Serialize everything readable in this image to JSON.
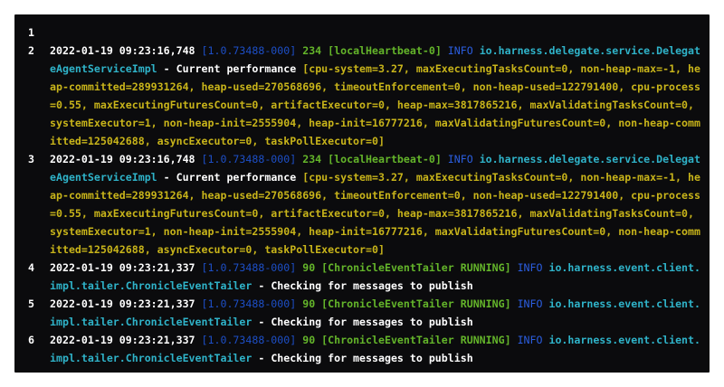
{
  "log": {
    "lines": [
      {
        "number": "1",
        "empty": true
      },
      {
        "number": "2",
        "timestamp": "2022-01-19 09:23:16,748",
        "version": "[1.0.73488-000]",
        "thread_id": "234",
        "thread": "[localHeartbeat-0]",
        "level": "INFO",
        "logger": "io.harness.delegate.service.DelegateAgentServiceImpl",
        "message": "- Current performance",
        "params": "[cpu-system=3.27, maxExecutingTasksCount=0, non-heap-max=-1, heap-committed=289931264, heap-used=270568696, timeoutEnforcement=0, non-heap-used=122791400, cpu-process=0.55, maxExecutingFuturesCount=0, artifactExecutor=0, heap-max=3817865216, maxValidatingTasksCount=0, systemExecutor=1, non-heap-init=2555904, heap-init=16777216, maxValidatingFuturesCount=0, non-heap-committed=125042688, asyncExecutor=0, taskPollExecutor=0]"
      },
      {
        "number": "3",
        "timestamp": "2022-01-19 09:23:16,748",
        "version": "[1.0.73488-000]",
        "thread_id": "234",
        "thread": "[localHeartbeat-0]",
        "level": "INFO",
        "logger": "io.harness.delegate.service.DelegateAgentServiceImpl",
        "message": "- Current performance",
        "params": "[cpu-system=3.27, maxExecutingTasksCount=0, non-heap-max=-1, heap-committed=289931264, heap-used=270568696, timeoutEnforcement=0, non-heap-used=122791400, cpu-process=0.55, maxExecutingFuturesCount=0, artifactExecutor=0, heap-max=3817865216, maxValidatingTasksCount=0, systemExecutor=1, non-heap-init=2555904, heap-init=16777216, maxValidatingFuturesCount=0, non-heap-committed=125042688, asyncExecutor=0, taskPollExecutor=0]"
      },
      {
        "number": "4",
        "timestamp": "2022-01-19 09:23:21,337",
        "version": "[1.0.73488-000]",
        "thread_id": "90",
        "thread": "[ChronicleEventTailer RUNNING]",
        "level": "INFO",
        "logger": "io.harness.event.client.impl.tailer.ChronicleEventTailer",
        "message": "- Checking for messages to publish",
        "params": ""
      },
      {
        "number": "5",
        "timestamp": "2022-01-19 09:23:21,337",
        "version": "[1.0.73488-000]",
        "thread_id": "90",
        "thread": "[ChronicleEventTailer RUNNING]",
        "level": "INFO",
        "logger": "io.harness.event.client.impl.tailer.ChronicleEventTailer",
        "message": "- Checking for messages to publish",
        "params": ""
      },
      {
        "number": "6",
        "timestamp": "2022-01-19 09:23:21,337",
        "version": "[1.0.73488-000]",
        "thread_id": "90",
        "thread": "[ChronicleEventTailer RUNNING]",
        "level": "INFO",
        "logger": "io.harness.event.client.impl.tailer.ChronicleEventTailer",
        "message": "- Checking for messages to publish",
        "params": ""
      }
    ]
  },
  "colors": {
    "background": "#0b0b0d",
    "timestamp": "#ffffff",
    "version": "#1d4fc7",
    "thread": "#64b52a",
    "level": "#2b5ee0",
    "logger": "#2fb3c9",
    "params": "#c8b41a"
  }
}
